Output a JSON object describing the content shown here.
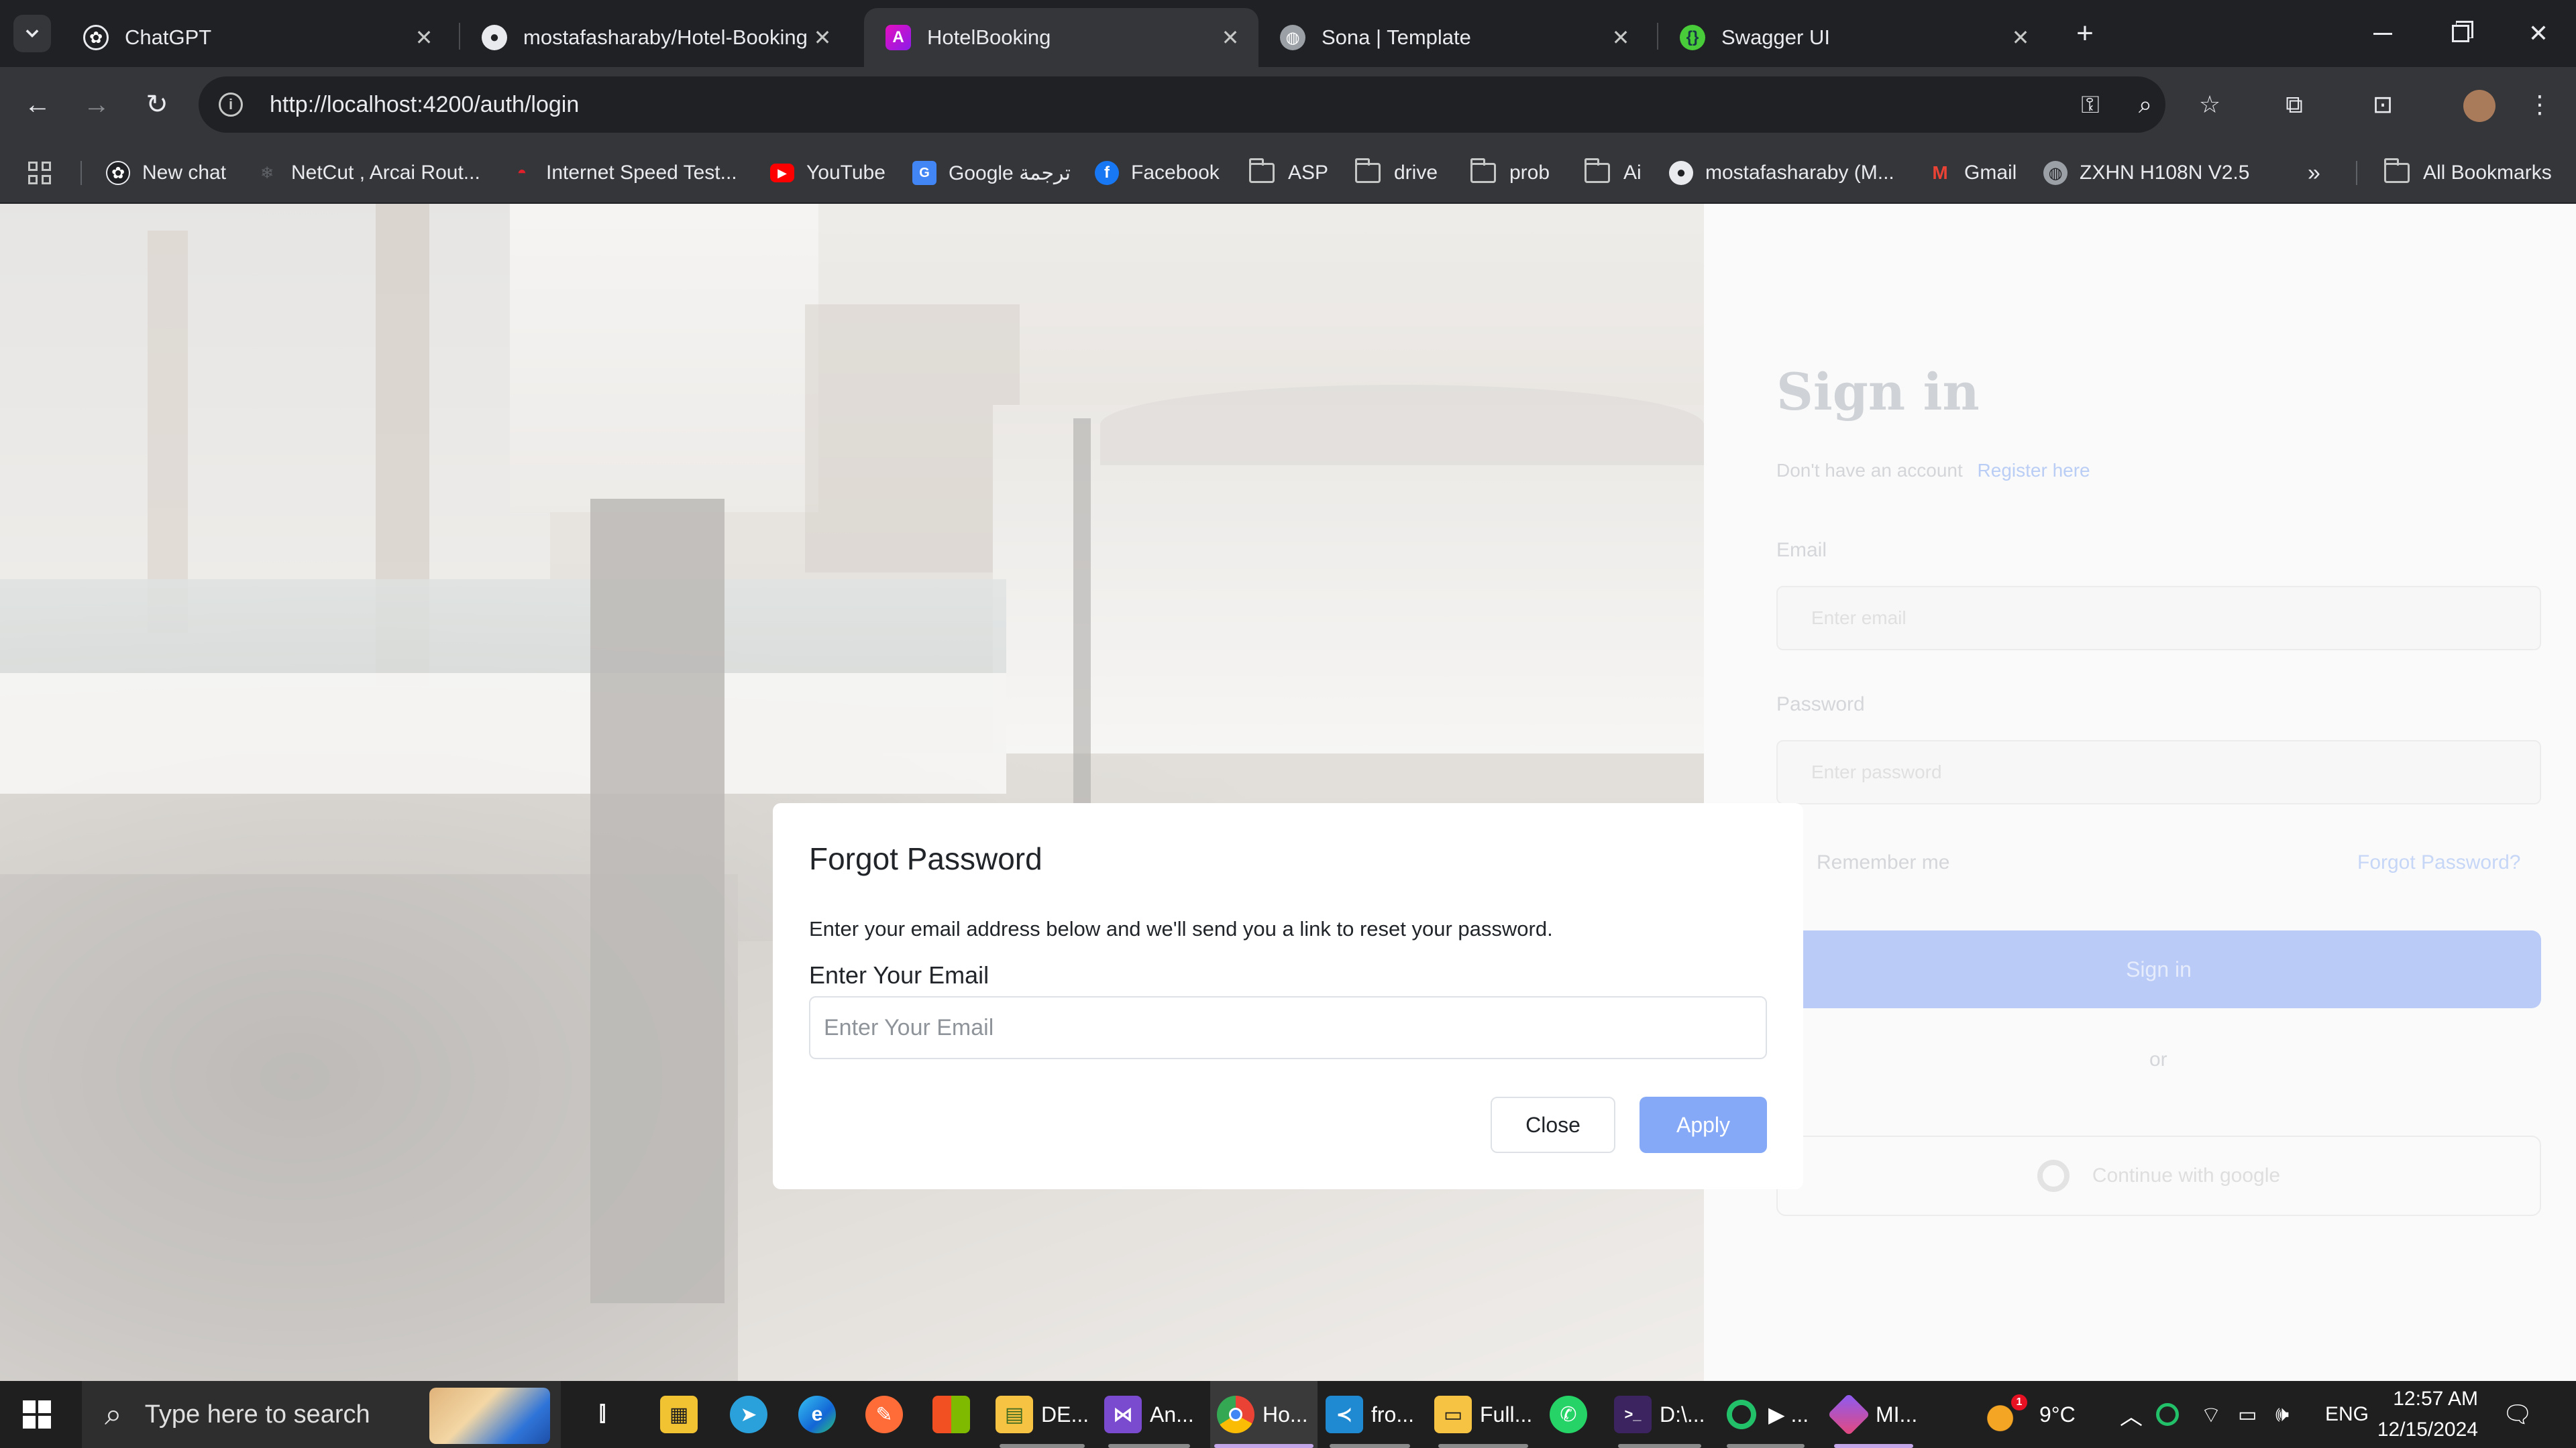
{
  "browser": {
    "tabs": [
      {
        "title": "ChatGPT",
        "icon": "chatgpt-icon",
        "active": false
      },
      {
        "title": "mostafasharaby/Hotel-Booking",
        "icon": "github-icon",
        "active": false
      },
      {
        "title": "HotelBooking",
        "icon": "angular-icon",
        "active": true
      },
      {
        "title": "Sona | Template",
        "icon": "globe-icon",
        "active": false
      },
      {
        "title": "Swagger UI",
        "icon": "swagger-icon",
        "active": false
      }
    ],
    "url": "http://localhost:4200/auth/login",
    "bookmarks": [
      {
        "label": "New chat",
        "icon": "chatgpt-icon"
      },
      {
        "label": "NetCut , Arcai Rout...",
        "icon": "netcut-icon"
      },
      {
        "label": "Internet Speed Test...",
        "icon": "speedtest-icon"
      },
      {
        "label": "YouTube",
        "icon": "youtube-icon"
      },
      {
        "label": "Google ترجمة",
        "icon": "google-translate-icon"
      },
      {
        "label": "Facebook",
        "icon": "facebook-icon"
      },
      {
        "label": "ASP",
        "icon": "folder-icon"
      },
      {
        "label": "drive",
        "icon": "folder-icon"
      },
      {
        "label": "prob",
        "icon": "folder-icon"
      },
      {
        "label": "Ai",
        "icon": "folder-icon"
      },
      {
        "label": "mostafasharaby (M...",
        "icon": "github-icon"
      },
      {
        "label": "Gmail",
        "icon": "gmail-icon"
      },
      {
        "label": "ZXHN H108N V2.5",
        "icon": "globe-icon"
      }
    ],
    "all_bookmarks": "All Bookmarks"
  },
  "login": {
    "title": "Sign in",
    "no_account": "Don't have an account",
    "register": "Register here",
    "email_label": "Email",
    "email_placeholder": "Enter email",
    "password_label": "Password",
    "password_placeholder": "Enter password",
    "remember": "Remember me",
    "forgot": "Forgot Password?",
    "signin_button": "Sign in",
    "or": "or",
    "google_button": "Continue with google"
  },
  "modal": {
    "title": "Forgot Password",
    "description": "Enter your email address below and we'll send you a link to reset your password.",
    "label": "Enter Your Email",
    "placeholder": "Enter Your Email",
    "close_label": "Close",
    "apply_label": "Apply",
    "apply_color": "#85a9f7"
  },
  "taskbar": {
    "search_placeholder": "Type here to search",
    "apps": [
      {
        "label": "",
        "icon": "store-icon"
      },
      {
        "label": "",
        "icon": "telegram-icon"
      },
      {
        "label": "",
        "icon": "edge-icon"
      },
      {
        "label": "",
        "icon": "postman-icon"
      },
      {
        "label": "",
        "icon": "office-icon"
      },
      {
        "label": "DE...",
        "icon": "file-explorer-icon"
      },
      {
        "label": "An...",
        "icon": "visual-studio-icon"
      },
      {
        "label": "Ho...",
        "icon": "chrome-icon"
      },
      {
        "label": "fro...",
        "icon": "vscode-icon"
      },
      {
        "label": "Full...",
        "icon": "folder-icon"
      },
      {
        "label": "",
        "icon": "whatsapp-icon"
      },
      {
        "label": "D:\\...",
        "icon": "terminal-icon"
      },
      {
        "label": "▶ ...",
        "icon": "media-icon"
      },
      {
        "label": "MI...",
        "icon": "git-icon"
      }
    ],
    "weather_badge": "1",
    "temperature": "9°C",
    "language": "ENG",
    "time": "12:57 AM",
    "date": "12/15/2024"
  }
}
